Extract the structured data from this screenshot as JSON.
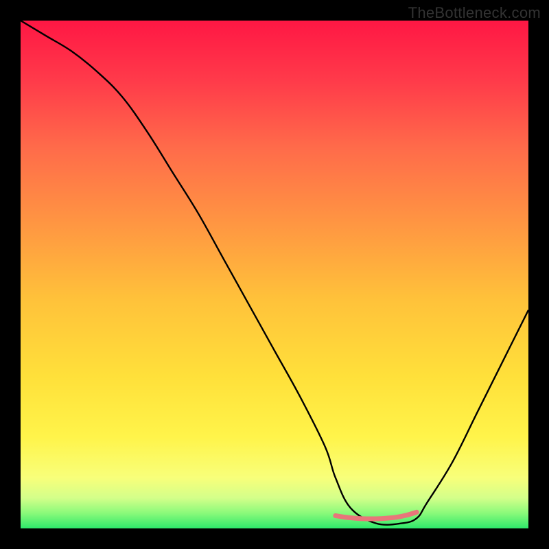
{
  "watermark": "TheBottleneck.com",
  "chart_data": {
    "type": "line",
    "title": "",
    "xlabel": "",
    "ylabel": "",
    "xlim": [
      0,
      100
    ],
    "ylim": [
      0,
      100
    ],
    "series": [
      {
        "name": "bottleneck-curve",
        "x": [
          0,
          5,
          10,
          15,
          20,
          25,
          30,
          35,
          40,
          45,
          50,
          55,
          60,
          62,
          65,
          70,
          75,
          78,
          80,
          85,
          90,
          95,
          100
        ],
        "values": [
          100,
          97,
          94,
          90,
          85,
          78,
          70,
          62,
          53,
          44,
          35,
          26,
          16,
          10,
          4,
          1,
          1,
          2,
          5,
          13,
          23,
          33,
          43
        ]
      },
      {
        "name": "optimal-marker",
        "x": [
          62,
          64,
          66,
          68,
          70,
          72,
          74,
          76,
          78
        ],
        "values": [
          2.5,
          2.2,
          2.0,
          1.9,
          1.9,
          2.0,
          2.2,
          2.6,
          3.2
        ]
      }
    ],
    "gradient_stops": [
      {
        "offset": 0.0,
        "color": "#ff1744"
      },
      {
        "offset": 0.12,
        "color": "#ff3b4a"
      },
      {
        "offset": 0.25,
        "color": "#ff6b4a"
      },
      {
        "offset": 0.4,
        "color": "#ff9642"
      },
      {
        "offset": 0.55,
        "color": "#ffc23a"
      },
      {
        "offset": 0.7,
        "color": "#ffe03a"
      },
      {
        "offset": 0.82,
        "color": "#fff44a"
      },
      {
        "offset": 0.9,
        "color": "#f8ff7a"
      },
      {
        "offset": 0.94,
        "color": "#d4ff8a"
      },
      {
        "offset": 0.97,
        "color": "#8afa7a"
      },
      {
        "offset": 1.0,
        "color": "#2ee86b"
      }
    ],
    "colors": {
      "curve": "#000000",
      "marker": "#e8767a",
      "frame": "#000000"
    }
  }
}
